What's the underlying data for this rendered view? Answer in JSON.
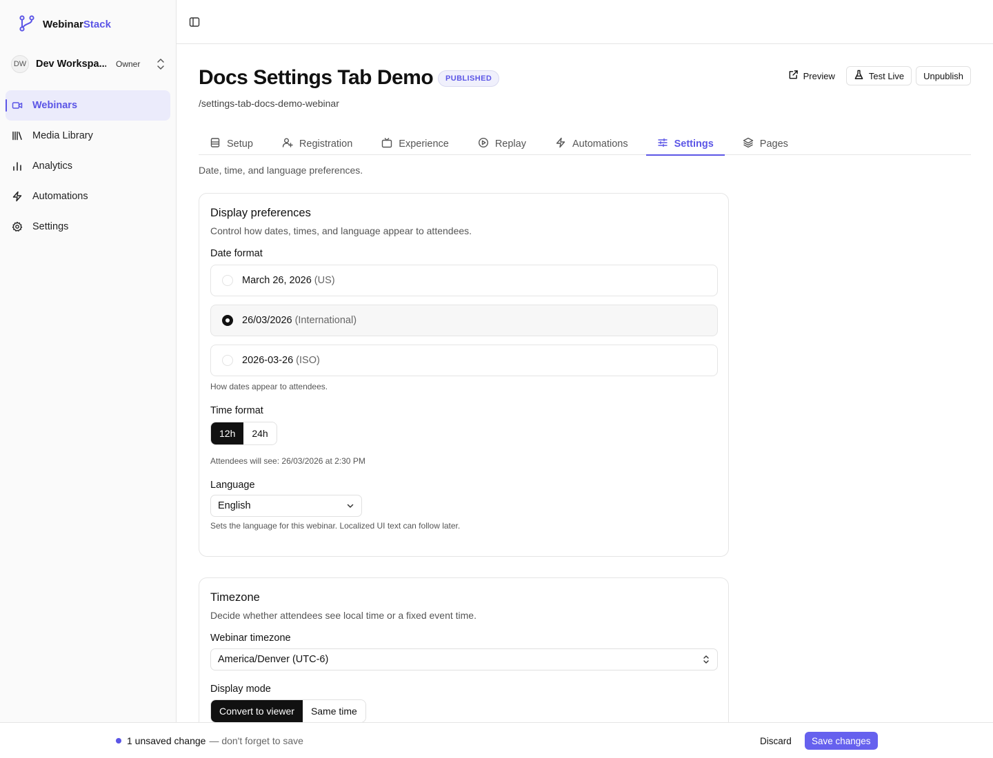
{
  "brand": {
    "name_main": "Webinar",
    "name_accent": "Stack",
    "accent_color": "#5b55e6"
  },
  "workspace": {
    "initials": "DW",
    "name": "Dev Workspa...",
    "role": "Owner"
  },
  "sidebar": {
    "items": [
      {
        "label": "Webinars",
        "icon": "video-icon",
        "active": true
      },
      {
        "label": "Media Library",
        "icon": "library-icon"
      },
      {
        "label": "Analytics",
        "icon": "bar-chart-icon"
      },
      {
        "label": "Automations",
        "icon": "zap-icon"
      },
      {
        "label": "Settings",
        "icon": "gear-icon"
      }
    ]
  },
  "header": {
    "title": "Docs Settings Tab Demo",
    "status": "PUBLISHED",
    "slug": "/settings-tab-docs-demo-webinar",
    "actions": {
      "preview": "Preview",
      "test_live": "Test Live",
      "unpublish": "Unpublish"
    }
  },
  "tabs": [
    {
      "label": "Setup",
      "icon": "layout-icon"
    },
    {
      "label": "Registration",
      "icon": "user-plus-icon"
    },
    {
      "label": "Experience",
      "icon": "tv-icon"
    },
    {
      "label": "Replay",
      "icon": "play-circle-icon"
    },
    {
      "label": "Automations",
      "icon": "zap-icon"
    },
    {
      "label": "Settings",
      "icon": "sliders-icon",
      "active": true
    },
    {
      "label": "Pages",
      "icon": "layers-icon"
    }
  ],
  "tab_description": "Date, time, and language preferences.",
  "display_preferences": {
    "title": "Display preferences",
    "description": "Control how dates, times, and language appear to attendees.",
    "date_format": {
      "label": "Date format",
      "options": [
        {
          "value": "March 26, 2026",
          "hint": "(US)",
          "selected": false
        },
        {
          "value": "26/03/2026",
          "hint": "(International)",
          "selected": true
        },
        {
          "value": "2026-03-26",
          "hint": "(ISO)",
          "selected": false
        }
      ],
      "help": "How dates appear to attendees."
    },
    "time_format": {
      "label": "Time format",
      "options": [
        "12h",
        "24h"
      ],
      "selected": "12h",
      "help": "Attendees will see: 26/03/2026 at 2:30 PM"
    },
    "language": {
      "label": "Language",
      "value": "English",
      "help": "Sets the language for this webinar. Localized UI text can follow later."
    }
  },
  "timezone": {
    "title": "Timezone",
    "description": "Decide whether attendees see local time or a fixed event time.",
    "webinar_timezone": {
      "label": "Webinar timezone",
      "value": "America/Denver (UTC-6)"
    },
    "display_mode": {
      "label": "Display mode",
      "options": [
        "Convert to viewer",
        "Same time"
      ],
      "selected": "Convert to viewer"
    }
  },
  "savebar": {
    "count": "1 unsaved change",
    "note": "— don't forget to save",
    "discard": "Discard",
    "save": "Save changes"
  }
}
